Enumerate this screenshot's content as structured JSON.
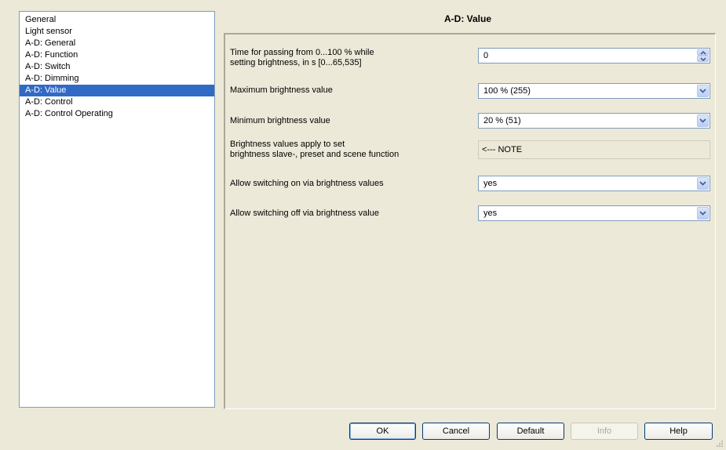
{
  "sidebar": {
    "items": [
      {
        "label": "General"
      },
      {
        "label": "Light sensor"
      },
      {
        "label": "A-D: General"
      },
      {
        "label": "A-D: Function"
      },
      {
        "label": "A-D: Switch"
      },
      {
        "label": "A-D: Dimming"
      },
      {
        "label": "A-D: Value"
      },
      {
        "label": "A-D: Control"
      },
      {
        "label": "A-D: Control Operating"
      }
    ],
    "selected_label": "A-D: Value"
  },
  "main": {
    "title": "A-D: Value",
    "params": [
      {
        "label_line1": "Time for passing from 0...100 % while",
        "label_line2": "setting brightness, in s [0...65,535]",
        "value": "0",
        "control": "spinner"
      },
      {
        "label": "Maximum brightness value",
        "value": "100 % (255)",
        "control": "dropdown"
      },
      {
        "label": "Minimum brightness value",
        "value": "20 %  (51)",
        "control": "dropdown"
      },
      {
        "label_line1": "Brightness values apply to set",
        "label_line2": "brightness slave-, preset and scene function",
        "value": "<--- NOTE",
        "control": "readonly"
      },
      {
        "label": "Allow switching on via brightness values",
        "value": "yes",
        "control": "dropdown"
      },
      {
        "label": "Allow switching off via brightness value",
        "value": "yes",
        "control": "dropdown"
      }
    ]
  },
  "buttons": {
    "ok": "OK",
    "cancel": "Cancel",
    "default": "Default",
    "info": "Info",
    "help": "Help"
  },
  "icons": {
    "dropdown": "chevron-down-icon",
    "spin_up": "spin-up-icon",
    "spin_down": "spin-down-icon",
    "grip": "resize-grip-icon"
  },
  "colors": {
    "selection": "#316ac5",
    "window_bg": "#ece9d8",
    "field_border": "#7f9db9"
  }
}
